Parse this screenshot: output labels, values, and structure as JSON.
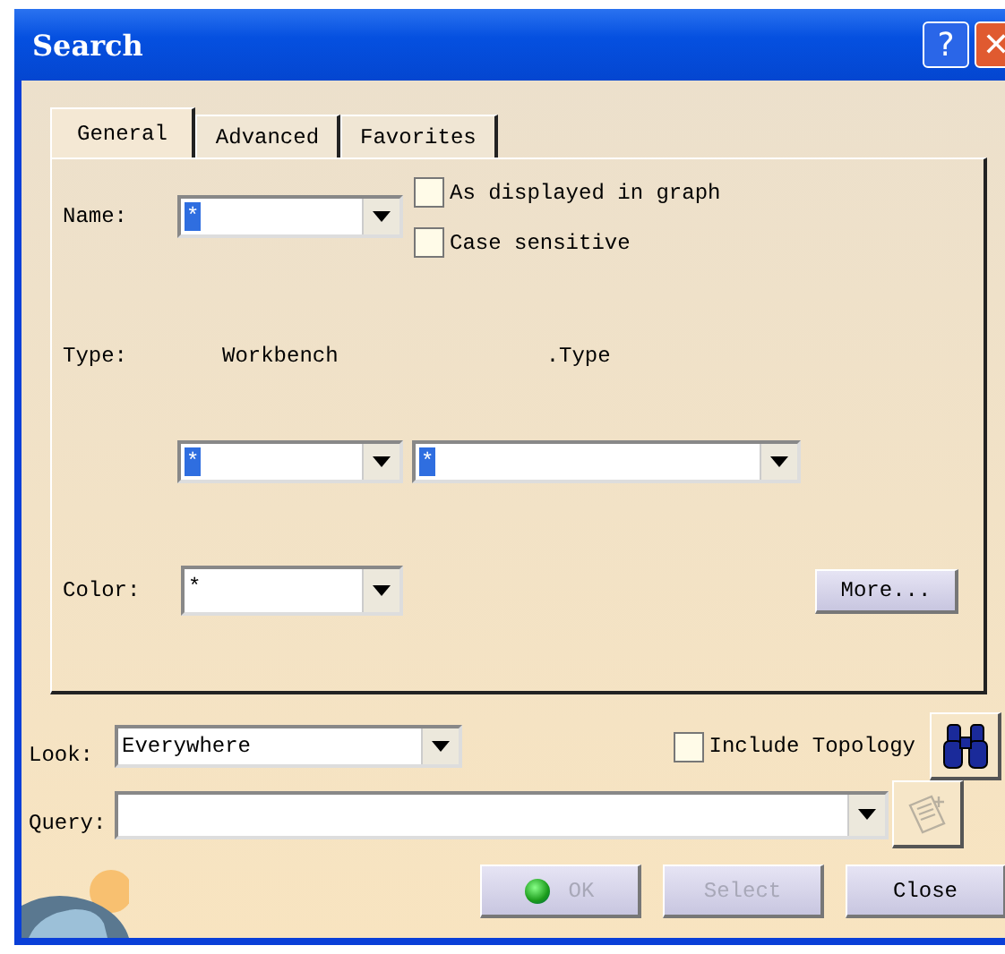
{
  "window": {
    "title": "Search",
    "help": "?",
    "close": "✕"
  },
  "tabs": [
    {
      "label": "General",
      "selected": true
    },
    {
      "label": "Advanced",
      "selected": false
    },
    {
      "label": "Favorites",
      "selected": false
    }
  ],
  "name": {
    "label": "Name:",
    "value": "*",
    "value_selected": true
  },
  "options": [
    {
      "label": "As displayed in graph",
      "checked": false
    },
    {
      "label": "Case sensitive",
      "checked": false
    }
  ],
  "type": {
    "label": "Type:",
    "column_1": "Workbench",
    "column_2": ".Type",
    "workbench_value": "*",
    "type_value": "*",
    "value_selected": true
  },
  "color": {
    "label": "Color:",
    "value": "*",
    "value_selected": false
  },
  "more_button": "More...",
  "look": {
    "label": "Look:",
    "value": "Everywhere"
  },
  "include_topology": {
    "label": "Include Topology",
    "checked": false
  },
  "query": {
    "label": "Query:"
  },
  "buttons": [
    {
      "label": "OK",
      "disabled": true,
      "kind": "ok"
    },
    {
      "label": "Select",
      "disabled": true,
      "kind": "plain"
    },
    {
      "label": "Close",
      "disabled": false,
      "kind": "plain"
    }
  ]
}
